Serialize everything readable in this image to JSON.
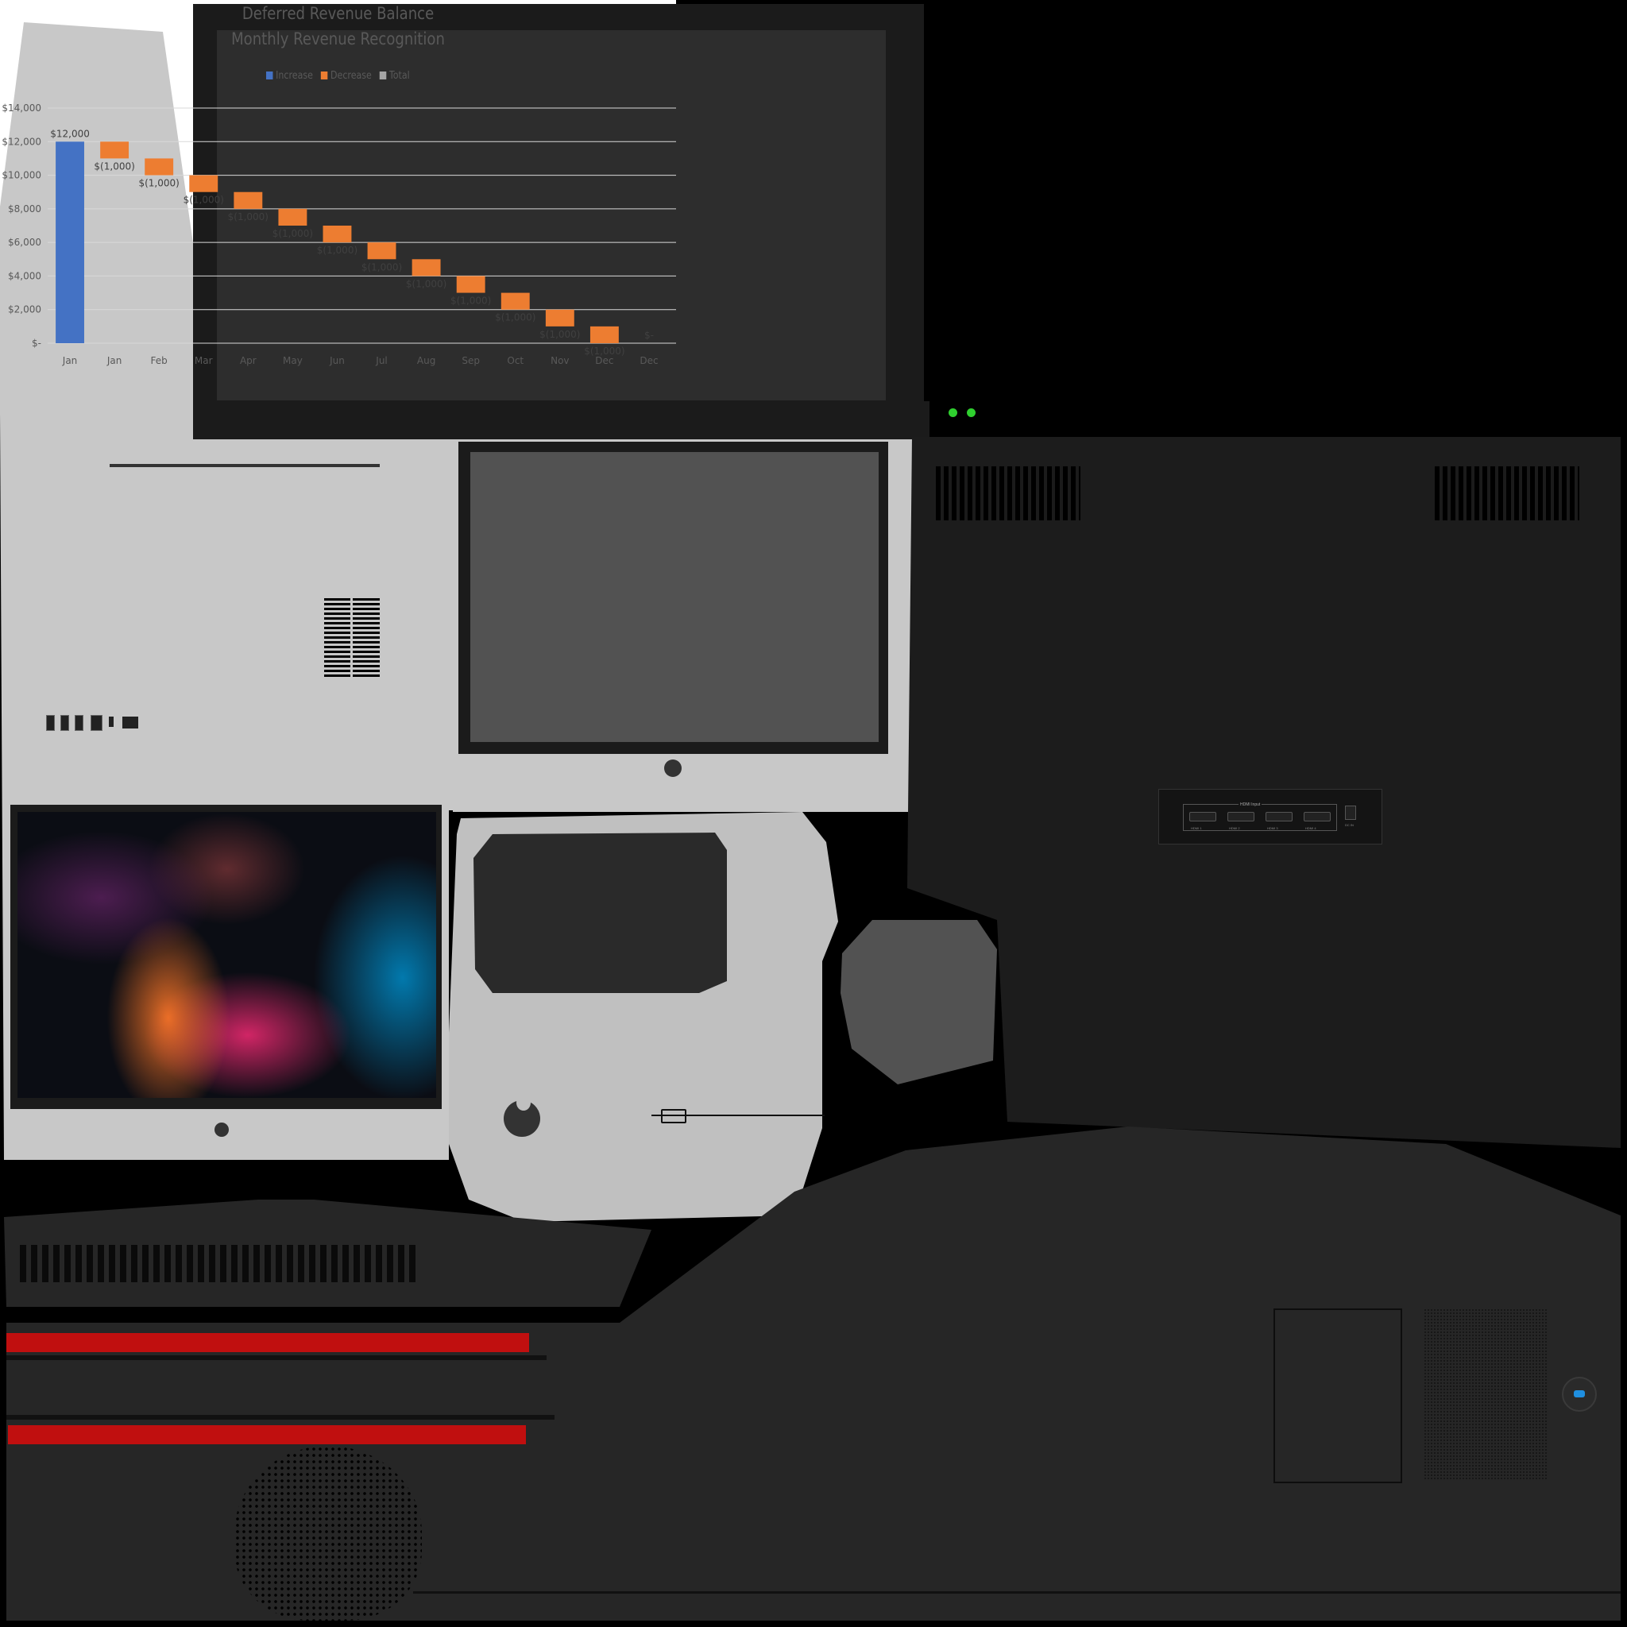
{
  "chart": {
    "title_line1": "Deferred Revenue Balance",
    "title_line2": "Monthly Revenue Recognition",
    "legend": [
      {
        "label": "Increase",
        "color": "#4472C4"
      },
      {
        "label": "Decrease",
        "color": "#ED7D31"
      },
      {
        "label": "Total",
        "color": "#A5A5A5"
      }
    ]
  },
  "chart_data": {
    "type": "bar",
    "subtype": "waterfall",
    "title": "Deferred Revenue Balance\nMonthly Revenue Recognition",
    "categories": [
      "Jan",
      "Jan",
      "Feb",
      "Mar",
      "Apr",
      "May",
      "Jun",
      "Jul",
      "Aug",
      "Sep",
      "Oct",
      "Nov",
      "Dec",
      "Dec"
    ],
    "values": [
      12000,
      -1000,
      -1000,
      -1000,
      -1000,
      -1000,
      -1000,
      -1000,
      -1000,
      -1000,
      -1000,
      -1000,
      -1000,
      0
    ],
    "data_labels": [
      "$12,000",
      "$(1,000)",
      "$(1,000)",
      "$(1,000)",
      "$(1,000)",
      "$(1,000)",
      "$(1,000)",
      "$(1,000)",
      "$(1,000)",
      "$(1,000)",
      "$(1,000)",
      "$(1,000)",
      "$(1,000)",
      "$-"
    ],
    "kinds": [
      "increase",
      "decrease",
      "decrease",
      "decrease",
      "decrease",
      "decrease",
      "decrease",
      "decrease",
      "decrease",
      "decrease",
      "decrease",
      "decrease",
      "decrease",
      "total"
    ],
    "y_ticks": [
      "$-",
      "$2,000",
      "$4,000",
      "$6,000",
      "$8,000",
      "$10,000",
      "$12,000",
      "$14,000"
    ],
    "ylim": [
      0,
      14000
    ],
    "grid": true,
    "legend_position": "top"
  },
  "hdmi_panel": {
    "title": "HDMI Input",
    "ports": [
      "HDMI 1",
      "HDMI 2",
      "HDMI 3",
      "HDMI 4"
    ],
    "power_label": "DC IN"
  },
  "colors": {
    "device_silver": "#c8c8c8",
    "device_dark": "#1c1c1c",
    "bezel_dark": "#1b1b1b",
    "accent_red": "#c00f0f",
    "indicator_green": "#2fd02f",
    "button_blue": "#1f8fe0"
  },
  "icons": [
    "usb-port-icon",
    "apple-logo-icon",
    "power-button-icon",
    "camera-button-icon",
    "hdmi-port-icon"
  ]
}
